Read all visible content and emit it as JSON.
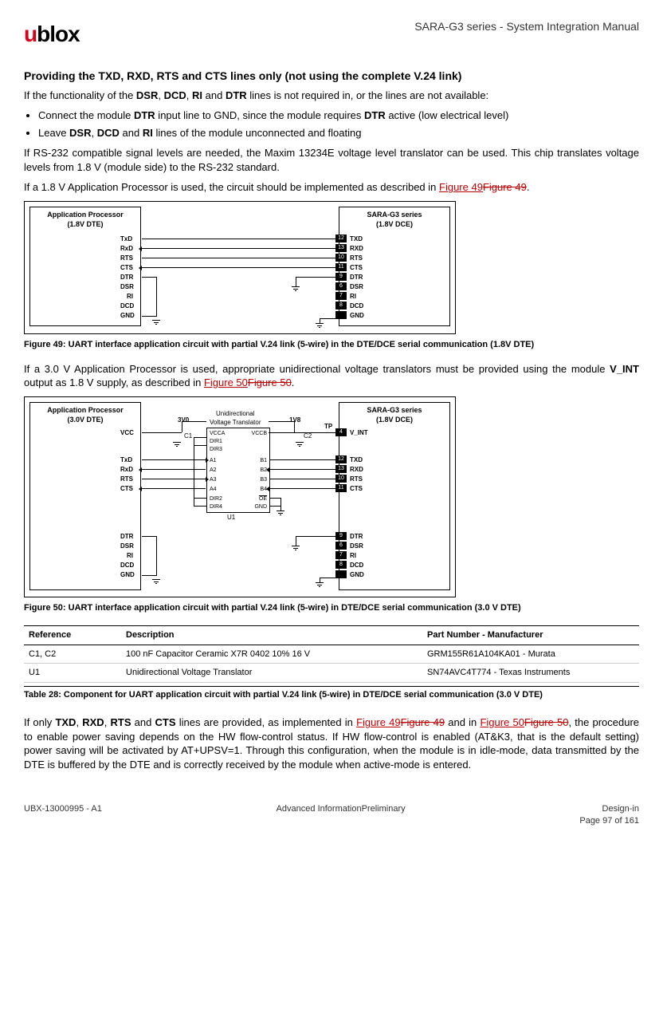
{
  "header": {
    "logo_text": "ublox",
    "doc_title": "SARA-G3 series - System Integration Manual"
  },
  "section_heading": "Providing the TXD, RXD, RTS and CTS lines only (not using the complete V.24 link)",
  "intro_para": "If the functionality of the DSR, DCD, RI and DTR lines is not required in, or the lines are not available:",
  "bullets": [
    "Connect the module DTR input line to GND, since the module requires DTR active (low electrical level)",
    "Leave DSR, DCD and RI lines of the module unconnected and floating"
  ],
  "para_rs232": "If RS-232 compatible signal levels are needed, the Maxim 13234E voltage level translator can be used. This chip translates voltage levels from 1.8 V (module side) to the RS-232 standard.",
  "para_fig49_prefix": "If a 1.8 V Application Processor is used, the circuit should be implemented as described in ",
  "para_fig49_link": "Figure 49",
  "para_fig49_strike": "Figure 49",
  "fig49": {
    "ap_title": "Application Processor\n(1.8V DTE)",
    "sara_title": "SARA-G3 series\n(1.8V DCE)",
    "ap_signals": [
      "TxD",
      "RxD",
      "RTS",
      "CTS",
      "DTR",
      "DSR",
      "RI",
      "DCD",
      "GND"
    ],
    "sara_pins": [
      {
        "num": "12",
        "name": "TXD"
      },
      {
        "num": "13",
        "name": "RXD"
      },
      {
        "num": "10",
        "name": "RTS"
      },
      {
        "num": "11",
        "name": "CTS"
      },
      {
        "num": "9",
        "name": "DTR"
      },
      {
        "num": "6",
        "name": "DSR"
      },
      {
        "num": "7",
        "name": "RI"
      },
      {
        "num": "8",
        "name": "DCD"
      },
      {
        "num": "",
        "name": "GND"
      }
    ],
    "caption": "Figure 49: UART interface application circuit with partial V.24 link (5-wire) in the DTE/DCE serial communication (1.8V DTE)"
  },
  "para_fig50_prefix": "If a 3.0 V Application Processor is used, appropriate unidirectional voltage translators must be provided using the module ",
  "para_fig50_vint": "V_INT",
  "para_fig50_mid": " output as 1.8 V supply, as described in ",
  "para_fig50_link": "Figure 50",
  "para_fig50_strike": "Figure 50",
  "fig50": {
    "ap_title": "Application Processor\n(3.0V DTE)",
    "sara_title": "SARA-G3 series\n(1.8V DCE)",
    "trans_label": "Unidirectional\nVoltage Translator",
    "v3": "3V0",
    "v18": "1V8",
    "tp": "TP",
    "c1": "C1",
    "c2": "C2",
    "u1": "U1",
    "chip_left": [
      "VCCA",
      "DIR1",
      "DIR3",
      "A1",
      "A2",
      "A3",
      "A4",
      "DIR2",
      "DIR4"
    ],
    "chip_right": [
      "VCCB",
      "",
      "",
      "B1",
      "B2",
      "B3",
      "B4",
      "OE",
      "GND"
    ],
    "ap_signals_top": [
      "VCC",
      "TxD",
      "RxD",
      "RTS",
      "CTS"
    ],
    "ap_signals_bot": [
      "DTR",
      "DSR",
      "RI",
      "DCD",
      "GND"
    ],
    "sara_pins_top": [
      {
        "num": "4",
        "name": "V_INT"
      },
      {
        "num": "12",
        "name": "TXD"
      },
      {
        "num": "13",
        "name": "RXD"
      },
      {
        "num": "10",
        "name": "RTS"
      },
      {
        "num": "11",
        "name": "CTS"
      }
    ],
    "sara_pins_bot": [
      {
        "num": "9",
        "name": "DTR"
      },
      {
        "num": "6",
        "name": "DSR"
      },
      {
        "num": "7",
        "name": "RI"
      },
      {
        "num": "8",
        "name": "DCD"
      },
      {
        "num": "",
        "name": "GND"
      }
    ],
    "caption": "Figure 50: UART interface application circuit with partial V.24 link (5-wire) in DTE/DCE serial communication (3.0 V DTE)"
  },
  "table": {
    "headers": [
      "Reference",
      "Description",
      "Part Number - Manufacturer"
    ],
    "rows": [
      [
        "C1, C2",
        "100 nF Capacitor Ceramic X7R 0402 10% 16 V",
        "GRM155R61A104KA01 - Murata"
      ],
      [
        "U1",
        "Unidirectional Voltage Translator",
        "SN74AVC4T774 - Texas Instruments"
      ]
    ],
    "caption": "Table 28: Component for UART application circuit with partial V.24 link (5-wire) in DTE/DCE serial communication (3.0 V DTE)"
  },
  "final_para_parts": {
    "p1": "If only ",
    "b1": "TXD",
    "c1": ", ",
    "b2": "RXD",
    "c2": ", ",
    "b3": "RTS",
    "c3": " and ",
    "b4": "CTS",
    "p2": " lines are provided, as implemented in ",
    "l1": "Figure 49",
    "s1": "Figure 49",
    "p3": " and in ",
    "l2": "Figure 50",
    "s2": "Figure 50",
    "p4": ", the procedure to enable power saving depends on the HW flow-control status. If HW flow-control is enabled (AT&K3, that is the default setting) power saving will be activated by AT+UPSV=1. Through this configuration, when the module is in idle-mode, data transmitted by the DTE is buffered by the DTE and is correctly received by the module when active-mode is entered."
  },
  "footer": {
    "left": "UBX-13000995 - A1",
    "center": "Advanced InformationPreliminary",
    "right_top": "Design-in",
    "right_bot": "Page 97 of 161"
  }
}
